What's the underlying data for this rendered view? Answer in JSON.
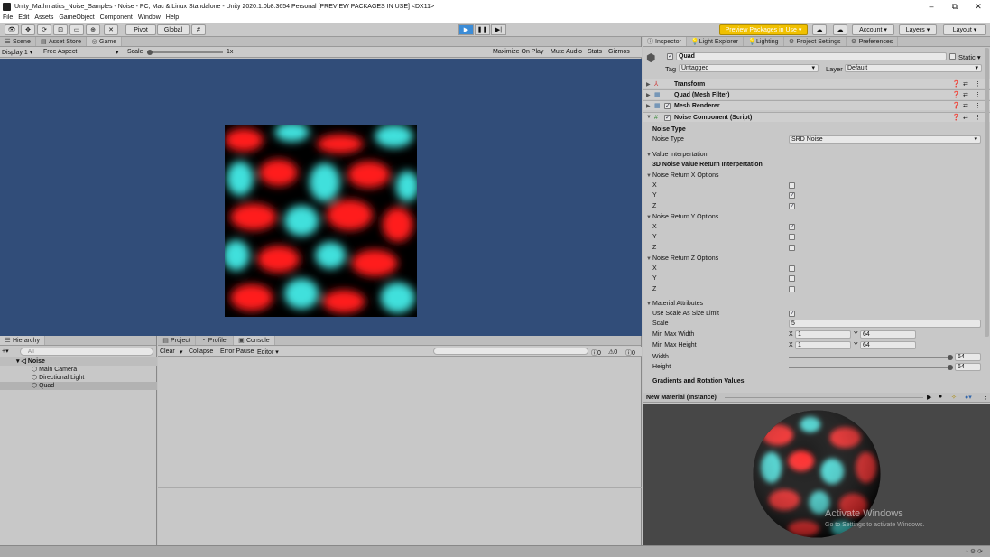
{
  "window": {
    "title": "Unity_Mathmatics_Noise_Samples - Noise - PC, Mac & Linux Standalone - Unity 2020.1.0b8.3654 Personal [PREVIEW PACKAGES IN USE] <DX11>",
    "minimize": "–",
    "maximize": "⧉",
    "close": "✕"
  },
  "menu": [
    "File",
    "Edit",
    "Assets",
    "GameObject",
    "Component",
    "Window",
    "Help"
  ],
  "toolbar": {
    "pivot": "Pivot",
    "global": "Global",
    "preview_packages": "Preview Packages in Use ▾",
    "account": "Account",
    "layers": "Layers",
    "layout": "Layout",
    "play_icon": "play-icon",
    "pause_icon": "pause-icon",
    "step_icon": "step-icon",
    "accent": "#3c8cd6",
    "preview_color": "#f0c000"
  },
  "scene_tabs": [
    "Scene",
    "Asset Store",
    "Game"
  ],
  "game_bar": {
    "display": "Display 1",
    "aspect": "Free Aspect",
    "scale_label": "Scale",
    "scale_value": "1x",
    "maximize": "Maximize On Play",
    "mute": "Mute Audio",
    "stats": "Stats",
    "gizmos": "Gizmos"
  },
  "game_bg": "#314d79",
  "hierarchy": {
    "tab": "Hierarchy",
    "add": "+▾",
    "search_placeholder": "All",
    "scene": "Noise",
    "items": [
      "Main Camera",
      "Directional Light",
      "Quad"
    ]
  },
  "console": {
    "tabs": [
      "Project",
      "Profiler",
      "Console"
    ],
    "clear": "Clear",
    "collapse": "Collapse",
    "error_pause": "Error Pause",
    "editor": "Editor",
    "counts": [
      "0",
      "0",
      "0"
    ]
  },
  "inspector": {
    "tabs": [
      "Inspector",
      "Light Explorer",
      "Lighting",
      "Project Settings",
      "Preferences"
    ],
    "object_name": "Quad",
    "static": "Static",
    "tag_label": "Tag",
    "tag_value": "Untagged",
    "layer_label": "Layer",
    "layer_value": "Default",
    "components": [
      "Transform",
      "Quad (Mesh Filter)",
      "Mesh Renderer",
      "Noise Component (Script)"
    ],
    "noise_type_header": "Noise Type",
    "noise_type_label": "Noise Type",
    "noise_type_value": "SRD Noise",
    "value_interp": "Value Interpertation",
    "value_interp_sub": "3D Noise Value Return Interpertation",
    "groups": [
      {
        "title": "Noise Return X Options",
        "x": "X",
        "y": "Y",
        "z": "Z",
        "checked": [
          false,
          true,
          true
        ]
      },
      {
        "title": "Noise Return Y Options",
        "x": "X",
        "y": "Y",
        "z": "Z",
        "checked": [
          true,
          false,
          false
        ]
      },
      {
        "title": "Noise Return Z Options",
        "x": "X",
        "y": "Y",
        "z": "Z",
        "checked": [
          false,
          false,
          false
        ]
      }
    ],
    "material_attrs": "Material Attributes",
    "use_scale": "Use Scale As Size Limit",
    "scale_label": "Scale",
    "scale_value": "5",
    "min_max_width": "Min Max Width",
    "mmw_x": "1",
    "mmw_y": "64",
    "min_max_height": "Min Max Height",
    "mmh_x": "1",
    "mmh_y": "64",
    "x_label": "X",
    "y_label": "Y",
    "width_label": "Width",
    "width_value": "64",
    "height_label": "Height",
    "height_value": "64",
    "gradients": "Gradients and Rotation Values"
  },
  "preview": {
    "title": "New Material (Instance)",
    "watermark_title": "Activate Windows",
    "watermark_sub": "Go to Settings to activate Windows."
  }
}
